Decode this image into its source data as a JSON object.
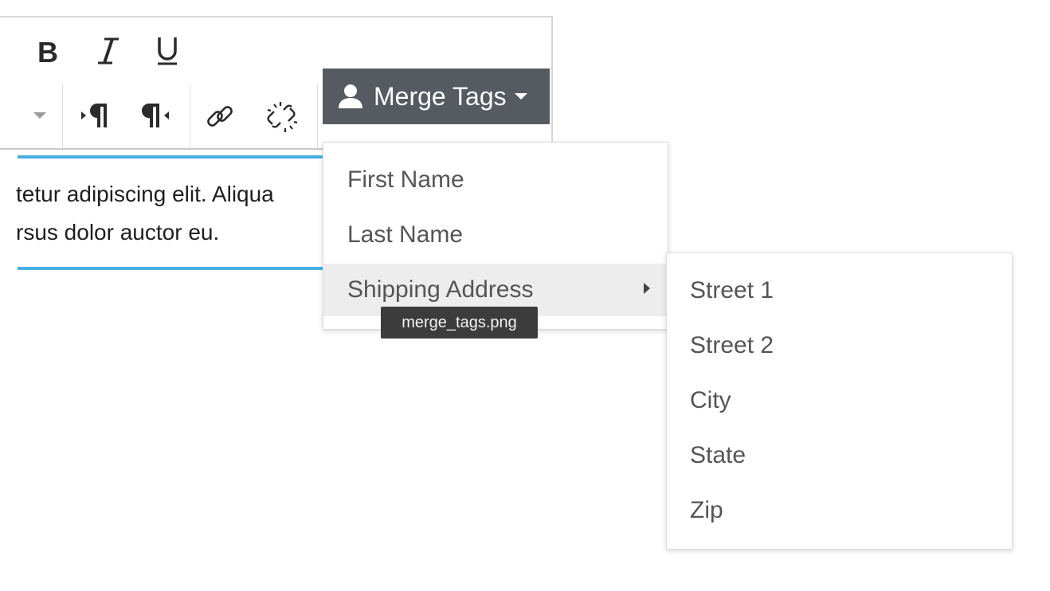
{
  "toolbar": {
    "bold_label": "B",
    "merge_tags_label": "Merge Tags",
    "icons": {
      "italic": "italic-icon",
      "underline": "underline-icon",
      "dropdown_caret": "chevron-down-icon",
      "ltr": "paragraph-ltr-icon",
      "rtl": "paragraph-rtl-icon",
      "link": "link-icon",
      "unlink": "unlink-icon",
      "user": "user-icon"
    }
  },
  "editor": {
    "line1": "tetur adipiscing elit. Aliqua",
    "line2": "rsus dolor auctor eu."
  },
  "menu": {
    "items": [
      {
        "label": "First Name"
      },
      {
        "label": "Last Name"
      },
      {
        "label": "Shipping Address"
      }
    ],
    "submenu": [
      {
        "label": "Street 1"
      },
      {
        "label": "Street 2"
      },
      {
        "label": "City"
      },
      {
        "label": "State"
      },
      {
        "label": "Zip"
      }
    ]
  },
  "tooltip": {
    "text": "merge_tags.png"
  },
  "colors": {
    "merge_button_bg": "#555b61",
    "editor_focus_line": "#48b0e4",
    "menu_active_bg": "#ededed",
    "tooltip_bg": "#3c3c3c"
  }
}
